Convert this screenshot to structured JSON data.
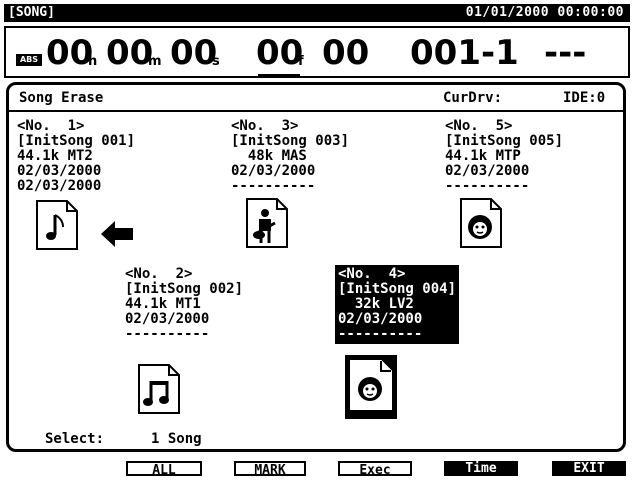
{
  "header": {
    "mode": "[SONG]",
    "datetime": "01/01/2000 00:00:00"
  },
  "counter": {
    "abs_label": "ABS",
    "hours": "00",
    "hours_unit": "h",
    "minutes": "00",
    "minutes_unit": "m",
    "seconds": "00",
    "seconds_unit": "s",
    "frames": "00",
    "frames_unit": "f",
    "subframes": "00",
    "measure": "001-1",
    "marker": "---"
  },
  "panel": {
    "title": "Song Erase",
    "curdrv_label": "CurDrv:",
    "curdrv_value": "IDE:0"
  },
  "songs": [
    {
      "no": "<No.  1>",
      "name": "[InitSong 001]",
      "format": "44.1k MT2",
      "date1": "02/03/2000",
      "date2": "02/03/2000",
      "icon": "note-icon"
    },
    {
      "no": "<No.  3>",
      "name": "[InitSong 003]",
      "format": "  48k MAS",
      "date1": "02/03/2000",
      "date2": "----------",
      "icon": "guitarist-icon"
    },
    {
      "no": "<No.  5>",
      "name": "[InitSong 005]",
      "format": "44.1k MTP",
      "date1": "02/03/2000",
      "date2": "----------",
      "icon": "face-icon"
    },
    {
      "no": "<No.  2>",
      "name": "[InitSong 002]",
      "format": "44.1k MT1",
      "date1": "02/03/2000",
      "date2": "----------",
      "icon": "double-note-icon"
    },
    {
      "no": "<No.  4>",
      "name": "[InitSong 004]",
      "format": "  32k LV2",
      "date1": "02/03/2000",
      "date2": "----------",
      "icon": "face-icon"
    }
  ],
  "select": {
    "label": "Select:",
    "value": "1 Song"
  },
  "function_buttons": {
    "all": "ALL",
    "mark": "MARK",
    "exec": "Exec",
    "time": "Time",
    "exit": "EXIT"
  }
}
